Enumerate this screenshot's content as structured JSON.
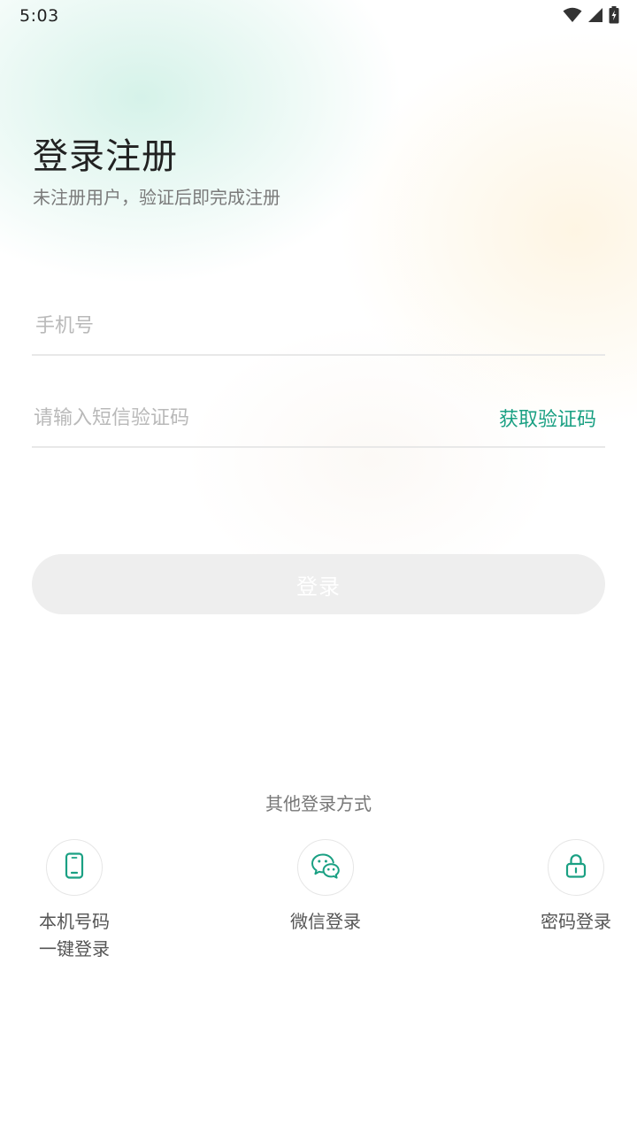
{
  "status_bar": {
    "time": "5:03",
    "icons": [
      "wifi-icon",
      "signal-icon",
      "battery-charging-icon"
    ]
  },
  "header": {
    "title": "登录注册",
    "subtitle": "未注册用户，验证后即完成注册"
  },
  "form": {
    "phone_placeholder": "手机号",
    "phone_value": "",
    "code_placeholder": "请输入短信验证码",
    "code_value": "",
    "get_code_label": "获取验证码"
  },
  "login_button": {
    "label": "登录"
  },
  "other_login": {
    "label": "其他登录方式",
    "methods": [
      {
        "label": "本机号码\n一键登录",
        "icon": "phone-icon"
      },
      {
        "label": "微信登录",
        "icon": "wechat-icon"
      },
      {
        "label": "密码登录",
        "icon": "lock-icon"
      }
    ]
  },
  "colors": {
    "accent": "#1aa083",
    "button_disabled": "#eeeeee",
    "title_text": "#222222",
    "placeholder": "#b9b9b9"
  }
}
